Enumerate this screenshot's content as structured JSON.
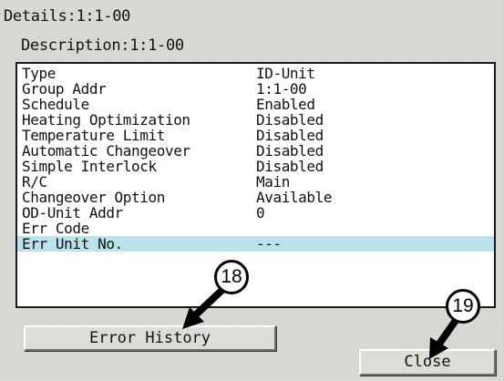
{
  "window": {
    "title": "Details:1:1-00",
    "description": "Description:1:1-00"
  },
  "details": {
    "selected_index": 11,
    "rows": [
      {
        "label": "Type",
        "value": "ID-Unit"
      },
      {
        "label": "Group Addr",
        "value": "1:1-00"
      },
      {
        "label": "Schedule",
        "value": "Enabled"
      },
      {
        "label": "Heating Optimization",
        "value": "Disabled"
      },
      {
        "label": "Temperature Limit",
        "value": "Disabled"
      },
      {
        "label": "Automatic Changeover",
        "value": "Disabled"
      },
      {
        "label": "Simple Interlock",
        "value": "Disabled"
      },
      {
        "label": "R/C",
        "value": "Main"
      },
      {
        "label": "Changeover Option",
        "value": "Available"
      },
      {
        "label": "OD-Unit Addr",
        "value": "0"
      },
      {
        "label": "Err Code",
        "value": ""
      },
      {
        "label": "Err Unit No.",
        "value": "---"
      }
    ]
  },
  "buttons": {
    "error_history": "Error History",
    "close": "Close"
  },
  "callouts": [
    {
      "number": "18",
      "target": "error-history-button"
    },
    {
      "number": "19",
      "target": "close-button"
    }
  ],
  "colors": {
    "background": "#d8d9d4",
    "panel": "#ffffff",
    "selected_row": "#b9e2ea",
    "callout_arrow": "#000000"
  }
}
